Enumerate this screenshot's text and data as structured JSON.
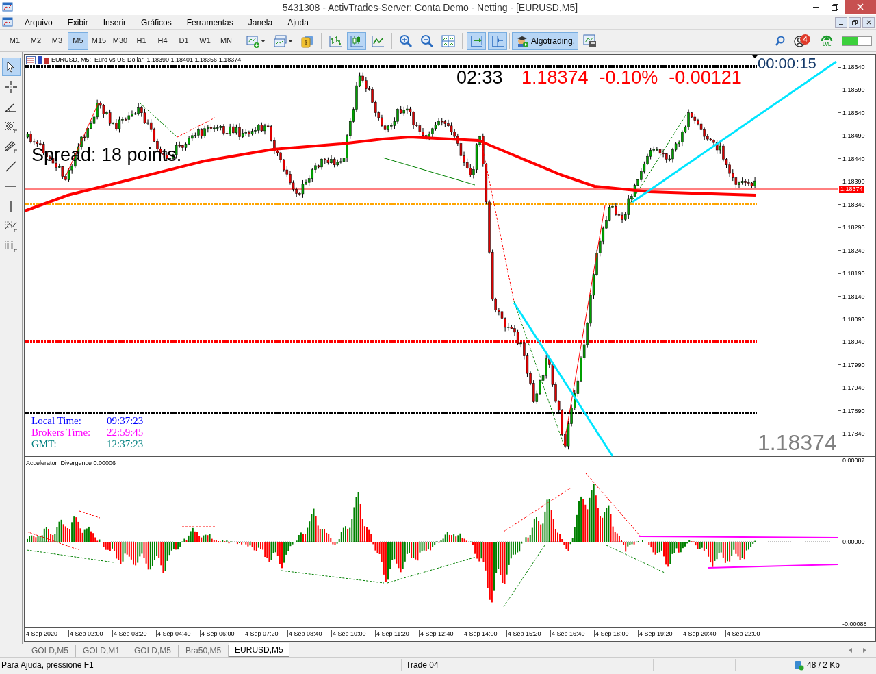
{
  "window": {
    "title": "5431308 - ActivTrades-Server: Conta Demo - Netting - [EURUSD,M5]"
  },
  "menu": [
    "Arquivo",
    "Exibir",
    "Inserir",
    "Gráficos",
    "Ferramentas",
    "Janela",
    "Ajuda"
  ],
  "timeframes": [
    {
      "label": "M1",
      "selected": false
    },
    {
      "label": "M2",
      "selected": false
    },
    {
      "label": "M3",
      "selected": false
    },
    {
      "label": "M5",
      "selected": true
    },
    {
      "label": "M15",
      "selected": false
    },
    {
      "label": "M30",
      "selected": false
    },
    {
      "label": "H1",
      "selected": false
    },
    {
      "label": "H4",
      "selected": false
    },
    {
      "label": "D1",
      "selected": false
    },
    {
      "label": "W1",
      "selected": false
    },
    {
      "label": "MN",
      "selected": false
    }
  ],
  "chart_tools": [
    {
      "kind": "new-chart",
      "selected": false
    },
    {
      "kind": "template",
      "selected": false
    },
    {
      "kind": "money",
      "selected": false
    },
    {
      "kind": "bars",
      "selected": false
    },
    {
      "kind": "candles",
      "selected": true
    },
    {
      "kind": "line",
      "selected": false
    },
    {
      "kind": "zoom-in",
      "selected": false
    },
    {
      "kind": "zoom-out",
      "selected": false
    },
    {
      "kind": "tile",
      "selected": false
    },
    {
      "kind": "autoscroll",
      "selected": true
    },
    {
      "kind": "shift",
      "selected": true
    }
  ],
  "algotrading": {
    "label": "Algotrading.",
    "selected": true
  },
  "notifications": {
    "count": "4"
  },
  "lvl": {
    "label": "LVL"
  },
  "drawing_tools": [
    {
      "kind": "cursor",
      "selected": true
    },
    {
      "kind": "crosshair",
      "selected": false
    },
    {
      "kind": "angle",
      "selected": false
    },
    {
      "kind": "grid",
      "selected": false
    },
    {
      "kind": "pitchfork",
      "selected": false
    },
    {
      "kind": "line",
      "selected": false
    },
    {
      "kind": "horizontal",
      "selected": false
    },
    {
      "kind": "vertical",
      "selected": false
    },
    {
      "kind": "fibo-e",
      "selected": false
    },
    {
      "kind": "fibo-f",
      "selected": false
    }
  ],
  "chart": {
    "header": "EURUSD, M5:  Euro vs US Dollar  1.18390 1.18401 1.18356 1.18374",
    "countdown": "02:33",
    "price_change": [
      "1.18374",
      "-0.10%",
      "-0.00121"
    ],
    "timer": "00:00:15",
    "spread": "Spread: 18 points.",
    "clock": [
      {
        "label": "Local Time:",
        "value": "09:37:23",
        "color": "#0000ff"
      },
      {
        "label": "Brokers Time:",
        "value": "22:59:45",
        "color": "#ff00ff"
      },
      {
        "label": "GMT:",
        "value": "12:37:23",
        "color": "#008080"
      }
    ],
    "bid_large": "1.18374",
    "current_price": "1.18374",
    "price_axis": [
      "1.18640",
      "1.18590",
      "1.18540",
      "1.18490",
      "1.18440",
      "1.18390",
      "1.18340",
      "1.18290",
      "1.18240",
      "1.18190",
      "1.18140",
      "1.18090",
      "1.18040",
      "1.17990",
      "1.17940",
      "1.17890",
      "1.17840"
    ]
  },
  "indicator": {
    "title": "Accelerator_Divergence 0.00006",
    "axis": [
      "0.00087",
      "0.00000",
      "-0.00088"
    ]
  },
  "time_axis": [
    "4 Sep 2020",
    "4 Sep 02:00",
    "4 Sep 03:20",
    "4 Sep 04:40",
    "4 Sep 06:00",
    "4 Sep 07:20",
    "4 Sep 08:40",
    "4 Sep 10:00",
    "4 Sep 11:20",
    "4 Sep 12:40",
    "4 Sep 14:00",
    "4 Sep 15:20",
    "4 Sep 16:40",
    "4 Sep 18:00",
    "4 Sep 19:20",
    "4 Sep 20:40",
    "4 Sep 22:00"
  ],
  "tabs": [
    {
      "label": "GOLD,M5",
      "selected": false
    },
    {
      "label": "GOLD,M1",
      "selected": false
    },
    {
      "label": "GOLD,M5",
      "selected": false
    },
    {
      "label": "Bra50,M5",
      "selected": false
    },
    {
      "label": "EURUSD,M5",
      "selected": true
    }
  ],
  "status_bar": {
    "help": "Para Ajuda, pressione F1",
    "profile": "Trade 04",
    "traffic": "48 / 2 Kb"
  }
}
